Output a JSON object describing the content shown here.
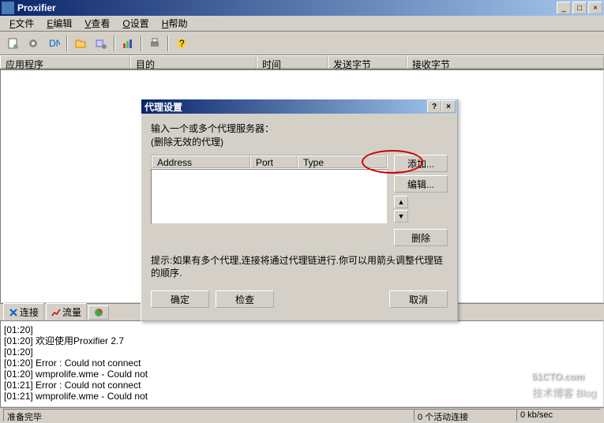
{
  "window": {
    "title": "Proxifier",
    "min": "_",
    "max": "□",
    "close": "×"
  },
  "menu": {
    "file_key": "F",
    "file": "文件",
    "edit_key": "E",
    "edit": "编辑",
    "view_key": "V",
    "view": "查看",
    "options_key": "O",
    "options": "设置",
    "help_key": "H",
    "help": "帮助"
  },
  "columns": {
    "app": "应用程序",
    "target": "目的",
    "time": "时间",
    "sent": "发送字节",
    "recv": "接收字节"
  },
  "tabs": {
    "connect": "连接",
    "traffic": "流量"
  },
  "log": [
    "[01:20]",
    "[01:20] 欢迎使用Proxifier 2.7",
    "[01:20]",
    "[01:20] Error : Could not connect",
    "[01:20] wmprolife.wme - Could not",
    "[01:21] Error : Could not connect",
    "[01:21] wmprolife.wme - Could not"
  ],
  "status": {
    "ready": "准备完毕",
    "active": "0 个活动连接",
    "speed": "0 kb/sec"
  },
  "dialog": {
    "title": "代理设置",
    "help": "?",
    "close": "×",
    "label1": "输入一个或多个代理服务器：",
    "label2": "(删除无效的代理)",
    "col_addr": "Address",
    "col_port": "Port",
    "col_type": "Type",
    "btn_add": "添加...",
    "btn_edit": "编辑...",
    "btn_up": "▲",
    "btn_down": "▼",
    "btn_del": "删除",
    "hint": "提示:如果有多个代理,连接将通过代理链进行.你可以用箭头调整代理链的顺序.",
    "btn_ok": "确定",
    "btn_check": "检查",
    "btn_cancel": "取消"
  },
  "watermark": {
    "main": "51CTO.com",
    "sub": "技术博客  Blog"
  }
}
